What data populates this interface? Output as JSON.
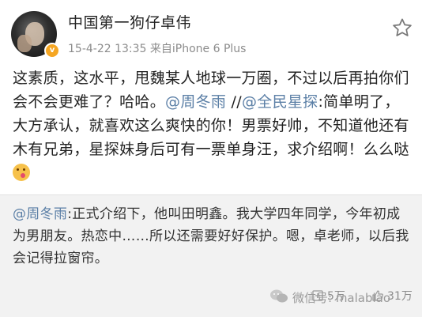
{
  "user": {
    "name": "中国第一狗仔卓伟",
    "meta": "15-4-22 13:35  来自iPhone 6 Plus",
    "verified_color": "#f5a623"
  },
  "post": {
    "text_1": "这素质，这水平，甩魏某人地球一万圈，不过以后再拍你们会不会更难了？哈哈。",
    "mention_1": "@周冬雨",
    "text_2": " //",
    "mention_2": "@全民星探",
    "text_3": ":简单明了，大方承认，就喜欢这么爽快的你！男票好帅，不知道他还有木有兄弟，星探妹身后可有一票单身汪，求介绍啊！么么哒",
    "emoji": "kiss-emoji"
  },
  "repost": {
    "mention": "@周冬雨",
    "text": ":正式介绍下，他叫田明鑫。我大学四年同学，今年初成为男朋友。热恋中……所以还需要好好保护。嗯，卓老师，以后我会记得拉窗帘。"
  },
  "actions": {
    "repost_count": "5万",
    "like_count": "31万"
  },
  "watermark": "微信号: malabiao",
  "colors": {
    "link": "#5b7fa6",
    "repost_bg": "#f2f2f2"
  }
}
